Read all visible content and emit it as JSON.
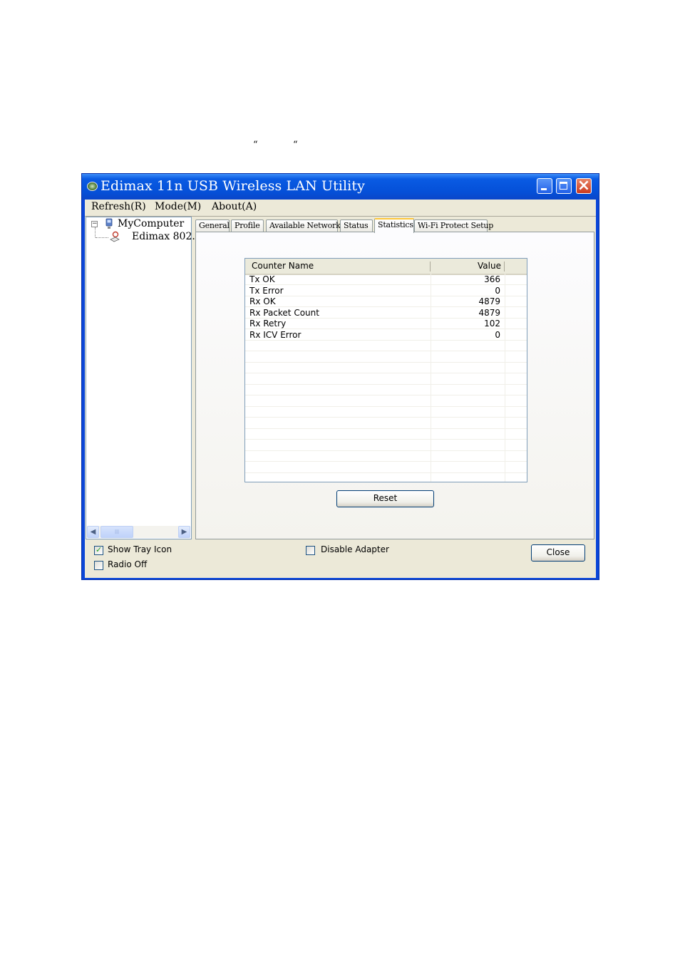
{
  "page": {
    "quote_marks": [
      "“",
      "“"
    ]
  },
  "window": {
    "title": "Edimax 11n USB Wireless LAN Utility",
    "menu": [
      "Refresh(R)",
      "Mode(M)",
      "About(A)"
    ],
    "tree": {
      "root": "MyComputer",
      "child": "Edimax 802."
    },
    "tabs": [
      "General",
      "Profile",
      "Available Network",
      "Status",
      "Statistics",
      "Wi-Fi Protect Setup"
    ],
    "active_tab": "Statistics",
    "statistics": {
      "columns": [
        "Counter Name",
        "Value"
      ],
      "rows": [
        {
          "name": "Tx OK",
          "value": "366"
        },
        {
          "name": "Tx Error",
          "value": "0"
        },
        {
          "name": "Rx OK",
          "value": "4879"
        },
        {
          "name": "Rx Packet Count",
          "value": "4879"
        },
        {
          "name": "Rx Retry",
          "value": "102"
        },
        {
          "name": "Rx ICV Error",
          "value": "0"
        }
      ],
      "reset_label": "Reset"
    },
    "footer": {
      "show_tray_icon": {
        "label": "Show Tray Icon",
        "checked": true
      },
      "radio_off": {
        "label": "Radio Off",
        "checked": false
      },
      "disable_adapter": {
        "label": "Disable Adapter",
        "checked": false
      },
      "close_label": "Close"
    }
  }
}
